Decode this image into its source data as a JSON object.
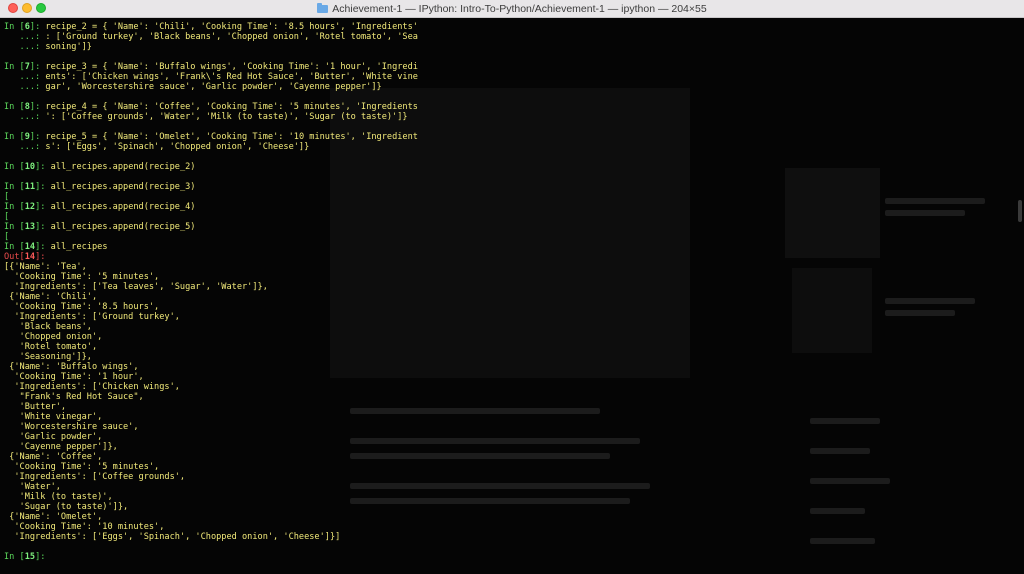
{
  "window": {
    "title": "Achievement-1 — IPython: Intro-To-Python/Achievement-1 — ipython — 204×55"
  },
  "terminal": {
    "lines": [
      {
        "kind": "in",
        "num": "6",
        "text": "recipe_2 = { 'Name': 'Chili', 'Cooking Time': '8.5 hours', 'Ingredients'"
      },
      {
        "kind": "cont",
        "prefix": "   ...: ",
        "text": ": ['Ground turkey', 'Black beans', 'Chopped onion', 'Rotel tomato', 'Sea"
      },
      {
        "kind": "cont",
        "prefix": "   ...: ",
        "text": "soning']}"
      },
      {
        "kind": "blank"
      },
      {
        "kind": "in",
        "num": "7",
        "text": "recipe_3 = { 'Name': 'Buffalo wings', 'Cooking Time': '1 hour', 'Ingredi"
      },
      {
        "kind": "cont",
        "prefix": "   ...: ",
        "text": "ents': ['Chicken wings', 'Frank\\'s Red Hot Sauce', 'Butter', 'White vine"
      },
      {
        "kind": "cont",
        "prefix": "   ...: ",
        "text": "gar', 'Worcestershire sauce', 'Garlic powder', 'Cayenne pepper']}"
      },
      {
        "kind": "blank"
      },
      {
        "kind": "in",
        "num": "8",
        "text": "recipe_4 = { 'Name': 'Coffee', 'Cooking Time': '5 minutes', 'Ingredients"
      },
      {
        "kind": "cont",
        "prefix": "   ...: ",
        "text": "': ['Coffee grounds', 'Water', 'Milk (to taste)', 'Sugar (to taste)']}"
      },
      {
        "kind": "blank"
      },
      {
        "kind": "in",
        "num": "9",
        "text": "recipe_5 = { 'Name': 'Omelet', 'Cooking Time': '10 minutes', 'Ingredient"
      },
      {
        "kind": "cont",
        "prefix": "   ...: ",
        "text": "s': ['Eggs', 'Spinach', 'Chopped onion', 'Cheese']}"
      },
      {
        "kind": "blank"
      },
      {
        "kind": "in",
        "num": "10",
        "text": "all_recipes.append(recipe_2)"
      },
      {
        "kind": "blank"
      },
      {
        "kind": "in",
        "num": "11",
        "text": "all_recipes.append(recipe_3)"
      },
      {
        "kind": "stub",
        "text": "["
      },
      {
        "kind": "in",
        "num": "12",
        "text": "all_recipes.append(recipe_4)"
      },
      {
        "kind": "stub",
        "text": "["
      },
      {
        "kind": "in",
        "num": "13",
        "text": "all_recipes.append(recipe_5)"
      },
      {
        "kind": "stub",
        "text": "["
      },
      {
        "kind": "in",
        "num": "14",
        "text": "all_recipes"
      },
      {
        "kind": "out",
        "num": "14"
      },
      {
        "kind": "text",
        "text": "[{'Name': 'Tea',"
      },
      {
        "kind": "text",
        "text": "  'Cooking Time': '5 minutes',"
      },
      {
        "kind": "text",
        "text": "  'Ingredients': ['Tea leaves', 'Sugar', 'Water']},"
      },
      {
        "kind": "text",
        "text": " {'Name': 'Chili',"
      },
      {
        "kind": "text",
        "text": "  'Cooking Time': '8.5 hours',"
      },
      {
        "kind": "text",
        "text": "  'Ingredients': ['Ground turkey',"
      },
      {
        "kind": "text",
        "text": "   'Black beans',"
      },
      {
        "kind": "text",
        "text": "   'Chopped onion',"
      },
      {
        "kind": "text",
        "text": "   'Rotel tomato',"
      },
      {
        "kind": "text",
        "text": "   'Seasoning']},"
      },
      {
        "kind": "text",
        "text": " {'Name': 'Buffalo wings',"
      },
      {
        "kind": "text",
        "text": "  'Cooking Time': '1 hour',"
      },
      {
        "kind": "text",
        "text": "  'Ingredients': ['Chicken wings',"
      },
      {
        "kind": "text",
        "text": "   \"Frank's Red Hot Sauce\","
      },
      {
        "kind": "text",
        "text": "   'Butter',"
      },
      {
        "kind": "text",
        "text": "   'White vinegar',"
      },
      {
        "kind": "text",
        "text": "   'Worcestershire sauce',"
      },
      {
        "kind": "text",
        "text": "   'Garlic powder',"
      },
      {
        "kind": "text",
        "text": "   'Cayenne pepper']},"
      },
      {
        "kind": "text",
        "text": " {'Name': 'Coffee',"
      },
      {
        "kind": "text",
        "text": "  'Cooking Time': '5 minutes',"
      },
      {
        "kind": "text",
        "text": "  'Ingredients': ['Coffee grounds',"
      },
      {
        "kind": "text",
        "text": "   'Water',"
      },
      {
        "kind": "text",
        "text": "   'Milk (to taste)',"
      },
      {
        "kind": "text",
        "text": "   'Sugar (to taste)']},"
      },
      {
        "kind": "text",
        "text": " {'Name': 'Omelet',"
      },
      {
        "kind": "text",
        "text": "  'Cooking Time': '10 minutes',"
      },
      {
        "kind": "text",
        "text": "  'Ingredients': ['Eggs', 'Spinach', 'Chopped onion', 'Cheese']}]"
      },
      {
        "kind": "blank"
      },
      {
        "kind": "in",
        "num": "15",
        "text": ""
      }
    ]
  },
  "colors": {
    "prompt_in": "#5bd85b",
    "prompt_out": "#e94b4b",
    "code": "#f2ea7a",
    "background": "#050505"
  },
  "icons": [
    "folder-icon"
  ]
}
